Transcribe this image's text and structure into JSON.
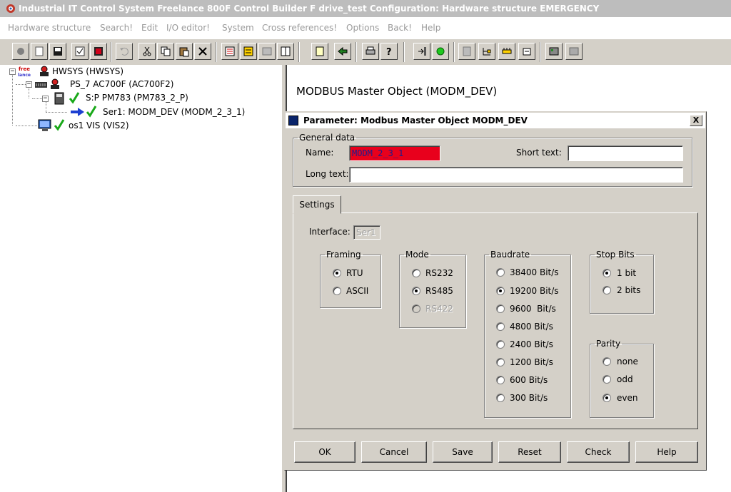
{
  "window": {
    "title": "Industrial IT Control System Freelance 800F Control Builder F drive_test  Configuration: Hardware structure  EMERGENCY"
  },
  "menu": [
    "Hardware structure",
    "Search!",
    "Edit",
    "I/O editor!",
    "System",
    "Cross references!",
    "Options",
    "Back!",
    "Help"
  ],
  "tree": {
    "root": {
      "label": "HWSYS (HWSYS)",
      "badge_top": "free",
      "badge_bottom": "lance"
    },
    "ps": {
      "label": "PS_7   AC700F (AC700F2)"
    },
    "sp": {
      "label": "S:P PM783 (PM783_2_P)"
    },
    "ser": {
      "label": "Ser1: MODM_DEV (MODM_2_3_1)"
    },
    "os": {
      "label": "os1  VIS (VIS2)"
    }
  },
  "right_pane": {
    "title": "MODBUS Master Object (MODM_DEV)"
  },
  "dialog": {
    "title": "Parameter: Modbus Master Object MODM_DEV",
    "close": "X",
    "general_data": {
      "legend": "General data",
      "name_label": "Name:",
      "name_value": "MODM_2_3_1",
      "short_text_label": "Short text:",
      "short_text_value": "",
      "long_text_label": "Long text:",
      "long_text_value": ""
    },
    "tab_settings": "Settings",
    "interface_label": "Interface:",
    "interface_value": "Ser1",
    "framing": {
      "legend": "Framing",
      "options": [
        "RTU",
        "ASCII"
      ],
      "selected": "RTU"
    },
    "mode": {
      "legend": "Mode",
      "options": [
        "RS232",
        "RS485",
        "RS422"
      ],
      "selected": "RS485",
      "disabled": [
        "RS422"
      ]
    },
    "baudrate": {
      "legend": "Baudrate",
      "options": [
        "38400 Bit/s",
        "19200 Bit/s",
        "9600  Bit/s",
        "4800 Bit/s",
        "2400 Bit/s",
        "1200 Bit/s",
        "600 Bit/s",
        "300 Bit/s"
      ],
      "selected": "19200 Bit/s"
    },
    "stop_bits": {
      "legend": "Stop Bits",
      "options": [
        "1 bit",
        "2 bits"
      ],
      "selected": "1 bit"
    },
    "parity": {
      "legend": "Parity",
      "options": [
        "none",
        "odd",
        "even"
      ],
      "selected": "even"
    },
    "buttons": {
      "ok": "OK",
      "cancel": "Cancel",
      "save": "Save",
      "reset": "Reset",
      "check": "Check",
      "help": "Help"
    }
  },
  "colors": {
    "name_field_bg": "#e8001c",
    "title_bg": "#bdbdbd",
    "face": "#d4d0c8",
    "arrow": "#1c3fd1",
    "check": "#18a818"
  }
}
